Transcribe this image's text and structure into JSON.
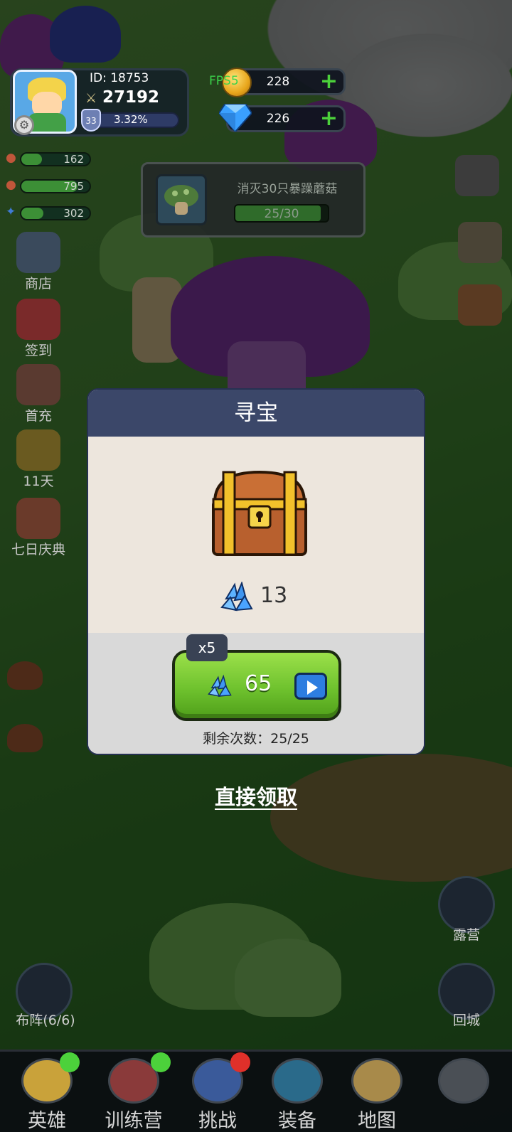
{
  "profile": {
    "id_label": "ID: 18753",
    "power": "27192",
    "level": "33",
    "exp_percent": "3.32%"
  },
  "resources": {
    "fps_text": "FPS5",
    "gold": "228",
    "gems": "226"
  },
  "stats": [
    {
      "value": "162"
    },
    {
      "value": "795"
    },
    {
      "value": "302"
    }
  ],
  "quest": {
    "text": "消灭30只暴躁蘑菇",
    "progress": "25/30"
  },
  "left_menu": [
    {
      "label": "商店",
      "icon": "shop-icon"
    },
    {
      "label": "签到",
      "icon": "gift-icon"
    },
    {
      "label": "首充",
      "icon": "archer-icon"
    },
    {
      "label": "11天",
      "icon": "coupon-icon"
    },
    {
      "label": "七日庆典",
      "icon": "present-icon"
    }
  ],
  "dialog": {
    "title": "寻宝",
    "reward_amount": "13",
    "multiplier": "x5",
    "button_amount": "65",
    "remaining": "剩余次数：25/25"
  },
  "direct_claim": "直接领取",
  "side_buttons": {
    "camp": "露营",
    "formation": "布阵(6/6)",
    "return_city": "回城"
  },
  "bottom_tabs": [
    {
      "label": "英雄",
      "icon": "hero-icon"
    },
    {
      "label": "训练营",
      "icon": "training-icon"
    },
    {
      "label": "挑战",
      "icon": "sword-icon"
    },
    {
      "label": "装备",
      "icon": "pot-icon"
    },
    {
      "label": "地图",
      "icon": "map-icon"
    },
    {
      "label": "",
      "icon": "locked-icon"
    }
  ],
  "colors": {
    "accent_green": "#6fc22e",
    "dialog_header": "#3b4769",
    "dialog_body": "#ede6dd"
  }
}
